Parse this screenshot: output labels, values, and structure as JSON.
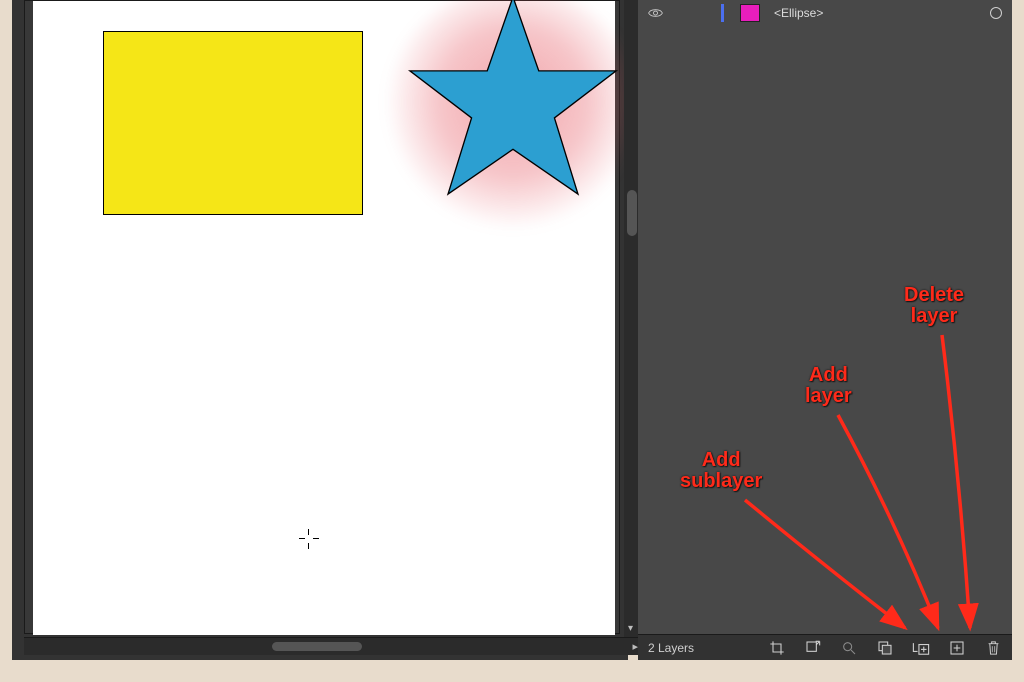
{
  "canvas": {
    "rectangle_color": "#f5e617",
    "star_fill": "#2c9fd1",
    "star_stroke": "#000000",
    "glow_color": "#e65a64"
  },
  "layers": {
    "row": {
      "name": "<Ellipse>",
      "swatch_color": "#e81ebc"
    },
    "footer": {
      "count_label": "2 Layers"
    }
  },
  "annotations": {
    "add_sublayer": "Add\nsublayer",
    "add_layer": "Add\nlayer",
    "delete_layer": "Delete\nlayer"
  },
  "icons": {
    "eye": "eye-icon",
    "crop": "crop-icon",
    "export": "export-icon",
    "search": "search-icon",
    "clip": "clipping-mask-icon",
    "add_sublayer": "add-sublayer-icon",
    "add_layer": "add-layer-icon",
    "trash": "trash-icon"
  }
}
